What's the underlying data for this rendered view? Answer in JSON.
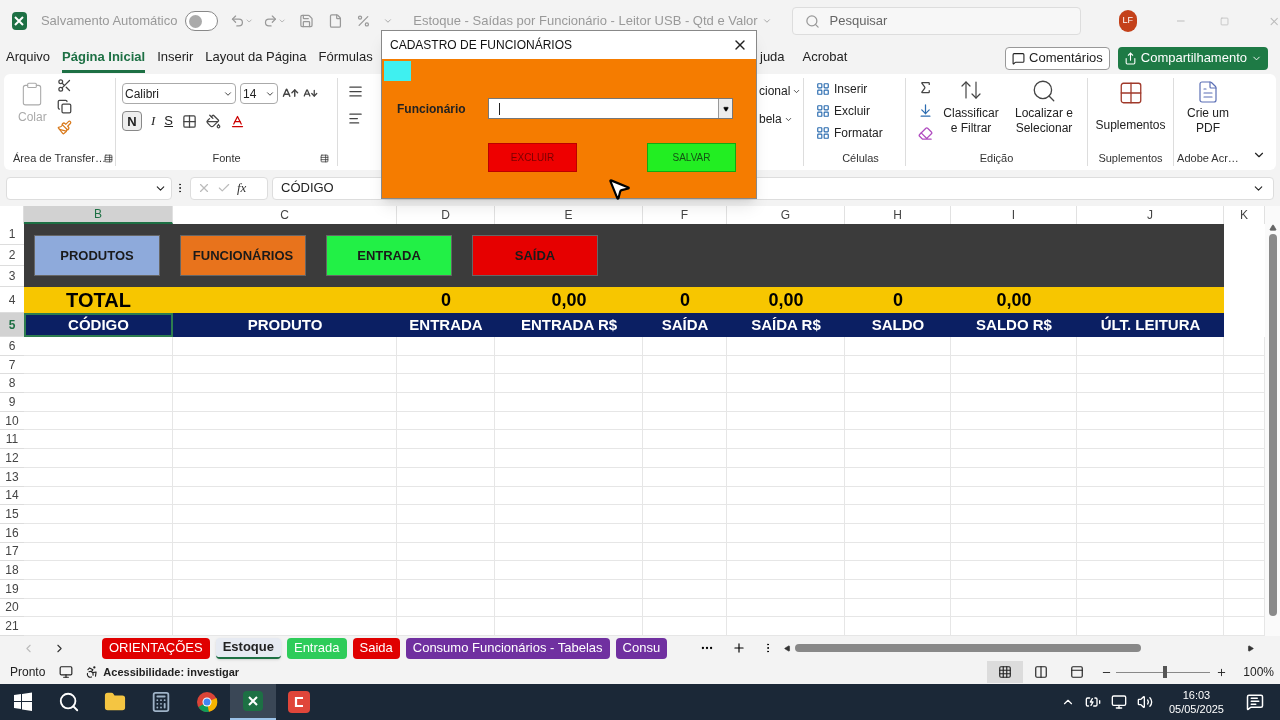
{
  "title_bar": {
    "autosave_label": "Salvamento Automático",
    "autosave_on": false,
    "document_title": "Estoque - Saídas por Funcionário - Leitor USB - Qtd e Valor",
    "search_placeholder": "Pesquisar",
    "user_initials": "LF"
  },
  "menu": [
    {
      "label": "Arquivo",
      "selected": false
    },
    {
      "label": "Página Inicial",
      "selected": true
    },
    {
      "label": "Inserir",
      "selected": false
    },
    {
      "label": "Layout da Página",
      "selected": false
    },
    {
      "label": "Fórmulas",
      "selected": false
    },
    {
      "label": "juda",
      "selected": false
    },
    {
      "label": "Acrobat",
      "selected": false
    }
  ],
  "actions": {
    "comments": "Comentários",
    "share": "Compartilhamento"
  },
  "ribbon": {
    "clipboard": {
      "paste": "Colar",
      "label": "Área de Transfer…"
    },
    "font": {
      "name": "Calibri",
      "size": "14",
      "bold": "N",
      "italic": "I",
      "underline": "S",
      "label": "Fonte"
    },
    "alignment_partial": [
      "cional",
      "bela"
    ],
    "cells": {
      "items": [
        "Inserir",
        "Excluir",
        "Formatar"
      ],
      "label": "Células"
    },
    "editing": {
      "sort": "Classificar e Filtrar",
      "find": "Localizar e Selecionar",
      "label": "Edição"
    },
    "addins": {
      "button": "Suplementos",
      "label": "Suplementos"
    },
    "adobe": {
      "button": "Crie um PDF",
      "label": "Adobe Acr…"
    }
  },
  "formula_bar": {
    "function_label": "fx",
    "formula": "CÓDIGO"
  },
  "sheet": {
    "columns": [
      {
        "label": "B",
        "selected": true
      },
      {
        "label": "C",
        "selected": false
      },
      {
        "label": "D",
        "selected": false
      },
      {
        "label": "E",
        "selected": false
      },
      {
        "label": "F",
        "selected": false
      },
      {
        "label": "G",
        "selected": false
      },
      {
        "label": "H",
        "selected": false
      },
      {
        "label": "I",
        "selected": false
      },
      {
        "label": "J",
        "selected": false
      },
      {
        "label": "K",
        "selected": false
      }
    ],
    "rows": [
      {
        "label": "1",
        "selected": false
      },
      {
        "label": "2",
        "selected": false
      },
      {
        "label": "3",
        "selected": false
      },
      {
        "label": "4",
        "selected": false
      },
      {
        "label": "5",
        "selected": true
      },
      {
        "label": "6",
        "selected": false
      },
      {
        "label": "7",
        "selected": false
      },
      {
        "label": "8",
        "selected": false
      },
      {
        "label": "9",
        "selected": false
      },
      {
        "label": "10",
        "selected": false
      },
      {
        "label": "11",
        "selected": false
      },
      {
        "label": "12",
        "selected": false
      },
      {
        "label": "13",
        "selected": false
      },
      {
        "label": "14",
        "selected": false
      },
      {
        "label": "15",
        "selected": false
      },
      {
        "label": "16",
        "selected": false
      },
      {
        "label": "17",
        "selected": false
      },
      {
        "label": "18",
        "selected": false
      },
      {
        "label": "19",
        "selected": false
      },
      {
        "label": "20",
        "selected": false
      },
      {
        "label": "21",
        "selected": false
      }
    ],
    "shape_buttons": [
      {
        "label": "PRODUTOS",
        "color": "#8eaadb"
      },
      {
        "label": "FUNCIONÁRIOS",
        "color": "#e8731c"
      },
      {
        "label": "ENTRADA",
        "color": "#22f046"
      },
      {
        "label": "SAÍDA",
        "color": "#e60000"
      }
    ],
    "totals": {
      "label": "TOTAL",
      "values": [
        "0",
        "0,00",
        "0",
        "0,00",
        "0",
        "0,00"
      ]
    },
    "headers": [
      "CÓDIGO",
      "PRODUTO",
      "ENTRADA",
      "ENTRADA R$",
      "SAÍDA",
      "SAÍDA R$",
      "SALDO",
      "SALDO R$",
      "ÚLT. LEITURA"
    ]
  },
  "dialog": {
    "title": "CADASTRO DE FUNCIONÁRIOS",
    "field_label": "Funcionário",
    "delete_button": "EXCLUIR",
    "save_button": "SALVAR"
  },
  "sheet_tabs": [
    {
      "label": "ORIENTAÇÕES",
      "color": "#e00000",
      "selected": false
    },
    {
      "label": "Estoque",
      "color": "#e6eaf2",
      "selected": true
    },
    {
      "label": "Entrada",
      "color": "#2ecc5a",
      "selected": false
    },
    {
      "label": "Saida",
      "color": "#e00000",
      "selected": false
    },
    {
      "label": "Consumo Funcionários - Tabelas",
      "color": "#7030a0",
      "selected": false
    },
    {
      "label": "Consu",
      "color": "#7030a0",
      "selected": false
    }
  ],
  "status": {
    "ready": "Pronto",
    "accessibility": "Acessibilidade: investigar",
    "zoom": "100%",
    "level": 0.5,
    "views": [
      {
        "kind": "normal",
        "selected": true
      },
      {
        "kind": "page_layout",
        "selected": false
      },
      {
        "kind": "page_break",
        "selected": false
      }
    ]
  },
  "taskbar": {
    "apps": [
      {
        "kind": "start",
        "selected": false
      },
      {
        "kind": "search",
        "selected": false
      },
      {
        "kind": "files",
        "selected": false
      },
      {
        "kind": "calculator",
        "selected": false
      },
      {
        "kind": "browser",
        "selected": false
      },
      {
        "kind": "excel",
        "selected": true
      },
      {
        "kind": "video",
        "selected": false
      }
    ],
    "time": "16:03",
    "date": "05/05/2025"
  }
}
